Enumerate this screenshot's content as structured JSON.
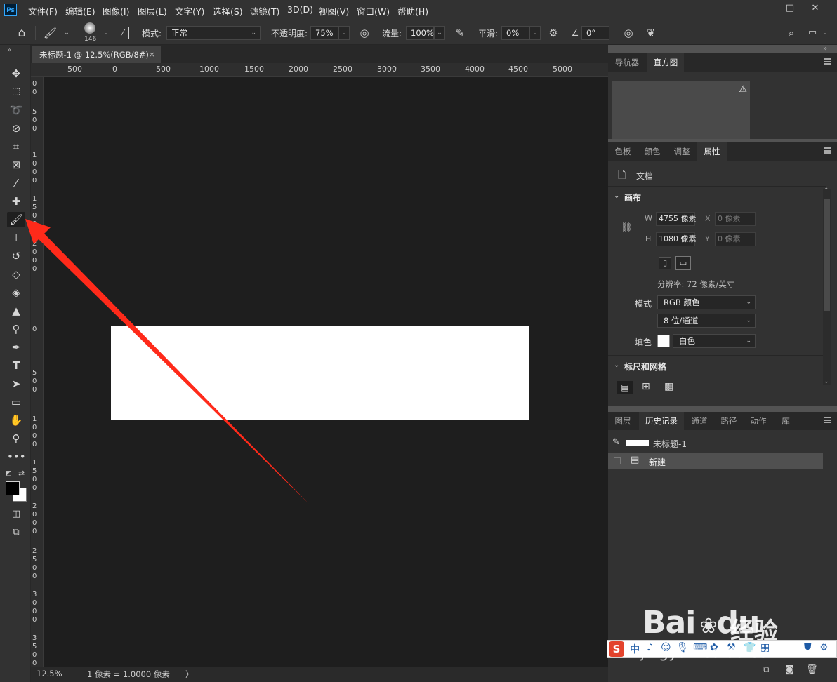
{
  "app": {
    "logo": "Ps"
  },
  "menu": [
    "文件(F)",
    "编辑(E)",
    "图像(I)",
    "图层(L)",
    "文字(Y)",
    "选择(S)",
    "滤镜(T)",
    "3D(D)",
    "视图(V)",
    "窗口(W)",
    "帮助(H)"
  ],
  "window_controls": {
    "minimize": "—",
    "maximize": "□",
    "close": "✕"
  },
  "options": {
    "brush_size": "146",
    "mode_label": "模式:",
    "mode_value": "正常",
    "opacity_label": "不透明度:",
    "opacity_value": "75%",
    "flow_label": "流量:",
    "flow_value": "100%",
    "smooth_label": "平滑:",
    "smooth_value": "0%",
    "angle_value": "0°"
  },
  "document": {
    "tab_title": "未标题-1 @ 12.5%(RGB/8#)",
    "close": "×",
    "zoom": "12.5%",
    "status_info": "1 像素 = 1.0000 像素",
    "status_arrow": "〉"
  },
  "ruler_top": [
    "500",
    "0",
    "500",
    "1000",
    "1500",
    "2000",
    "2500",
    "3000",
    "3500",
    "4000",
    "4500",
    "5000"
  ],
  "ruler_left": [
    "0\n0",
    "5\n0\n0",
    "1\n0\n0\n0",
    "1\n5\n0\n0",
    "2\n0\n0\n0",
    "0",
    "5\n0\n0",
    "1\n0\n0\n0",
    "1\n5\n0\n0",
    "2\n0\n0\n0",
    "2\n5\n0\n0",
    "3\n0\n0\n0",
    "3\n5\n0\n0"
  ],
  "panel_top": {
    "tabs": [
      "导航器",
      "直方图"
    ],
    "active": "直方图",
    "warning_icon": "⚠"
  },
  "panel_props": {
    "tabs": [
      "色板",
      "颜色",
      "调整",
      "属性"
    ],
    "active": "属性",
    "doc_label": "文档",
    "canvas_section": "画布",
    "w_label": "W",
    "w_value": "4755 像素",
    "h_label": "H",
    "h_value": "1080 像素",
    "x_label": "X",
    "x_value": "0 像素",
    "y_label": "Y",
    "y_value": "0 像素",
    "resolution": "分辨率: 72 像素/英寸",
    "mode_label": "模式",
    "mode_value": "RGB 颜色",
    "depth_value": "8 位/通道",
    "fill_label": "填色",
    "fill_value": "白色",
    "rulers_section": "标尺和网格"
  },
  "panel_history": {
    "tabs": [
      "图层",
      "历史记录",
      "通道",
      "路径",
      "动作",
      "库"
    ],
    "active": "历史记录",
    "snapshot_name": "未标题-1",
    "items": [
      "新建"
    ]
  },
  "watermark": {
    "brand": "Bai",
    "brand_paw": "du",
    "product": "经验",
    "url": "jingyan.baidu.com"
  },
  "ime": {
    "logo": "S",
    "lang": "中"
  },
  "colors": {
    "annotation_arrow": "#ff2a1a",
    "canvas_bg": "#1e1e1e",
    "document_fill": "#ffffff"
  }
}
